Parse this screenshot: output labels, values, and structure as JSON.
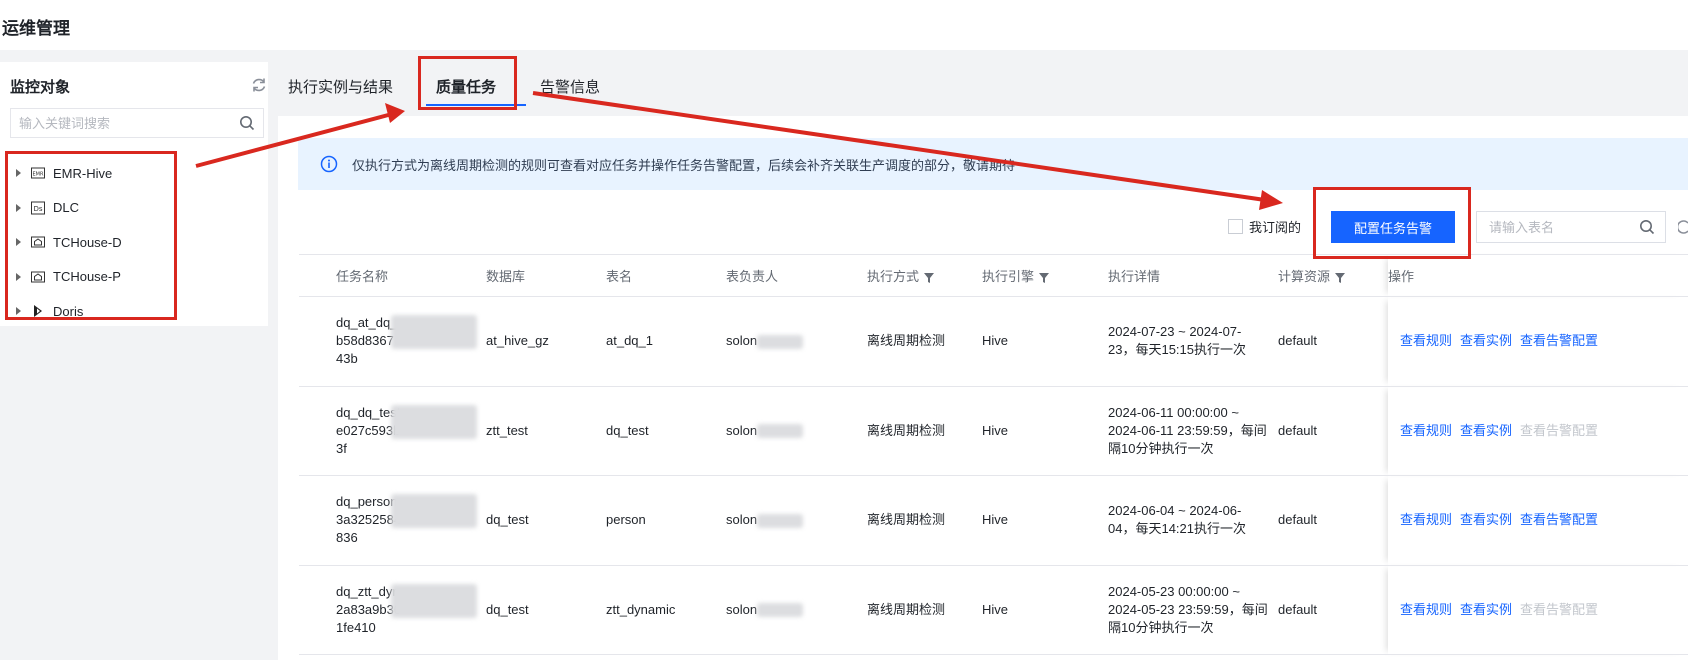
{
  "page": {
    "title": "运维管理"
  },
  "sidebar": {
    "title": "监控对象",
    "search_placeholder": "输入关键词搜索",
    "items": [
      {
        "label": "EMR-Hive",
        "icon": "emr-icon"
      },
      {
        "label": "DLC",
        "icon": "dlc-icon"
      },
      {
        "label": "TCHouse-D",
        "icon": "tchouse-icon"
      },
      {
        "label": "TCHouse-P",
        "icon": "tchouse-icon"
      },
      {
        "label": "Doris",
        "icon": "doris-icon"
      }
    ]
  },
  "tabs": [
    {
      "label": "执行实例与结果",
      "active": false
    },
    {
      "label": "质量任务",
      "active": true
    },
    {
      "label": "告警信息",
      "active": false
    }
  ],
  "notice": {
    "text": "仅执行方式为离线周期检测的规则可查看对应任务并操作任务告警配置，后续会补齐关联生产调度的部分，敬请期待"
  },
  "toolbar": {
    "checkbox_label": "我订阅的",
    "config_button": "配置任务告警",
    "search_placeholder": "请输入表名"
  },
  "table": {
    "columns": [
      "任务名称",
      "数据库",
      "表名",
      "表负责人",
      "执行方式",
      "执行引擎",
      "执行详情",
      "计算资源",
      "操作"
    ],
    "rows": [
      {
        "name_lines": [
          "dq_at_dq_",
          "b58d8367",
          "43b"
        ],
        "db": "at_hive_gz",
        "table": "at_dq_1",
        "owner": "solon",
        "mode": "离线周期检测",
        "engine": "Hive",
        "detail_lines": [
          "2024-07-23 ~ 2024-07-",
          "23，每天15:15执行一次"
        ],
        "resource": "default",
        "ops": [
          {
            "label": "查看规则",
            "enabled": true
          },
          {
            "label": "查看实例",
            "enabled": true
          },
          {
            "label": "查看告警配置",
            "enabled": true
          }
        ]
      },
      {
        "name_lines": [
          "dq_dq_test",
          "e027c593b",
          "3f"
        ],
        "db": "ztt_test",
        "table": "dq_test",
        "owner": "solon",
        "mode": "离线周期检测",
        "engine": "Hive",
        "detail_lines": [
          "2024-06-11 00:00:00 ~",
          "2024-06-11 23:59:59，每间",
          "隔10分钟执行一次"
        ],
        "resource": "default",
        "ops": [
          {
            "label": "查看规则",
            "enabled": true
          },
          {
            "label": "查看实例",
            "enabled": true
          },
          {
            "label": "查看告警配置",
            "enabled": false
          }
        ]
      },
      {
        "name_lines": [
          "dq_person_",
          "3a3252584",
          "836"
        ],
        "db": "dq_test",
        "table": "person",
        "owner": "solon",
        "mode": "离线周期检测",
        "engine": "Hive",
        "detail_lines": [
          "2024-06-04 ~ 2024-06-",
          "04，每天14:21执行一次"
        ],
        "resource": "default",
        "ops": [
          {
            "label": "查看规则",
            "enabled": true
          },
          {
            "label": "查看实例",
            "enabled": true
          },
          {
            "label": "查看告警配置",
            "enabled": true
          }
        ]
      },
      {
        "name_lines": [
          "dq_ztt_dyr",
          "2a83a9b30",
          "1fe410"
        ],
        "db": "dq_test",
        "table": "ztt_dynamic",
        "owner": "solon",
        "mode": "离线周期检测",
        "engine": "Hive",
        "detail_lines": [
          "2024-05-23 00:00:00 ~",
          "2024-05-23 23:59:59，每间",
          "隔10分钟执行一次"
        ],
        "resource": "default",
        "ops": [
          {
            "label": "查看规则",
            "enabled": true
          },
          {
            "label": "查看实例",
            "enabled": true
          },
          {
            "label": "查看告警配置",
            "enabled": false
          }
        ]
      }
    ]
  },
  "colors": {
    "primary": "#1664ff",
    "annotation": "#d9281f",
    "notice_bg": "#e8f3ff",
    "disabled_link": "#c2c6cc"
  }
}
